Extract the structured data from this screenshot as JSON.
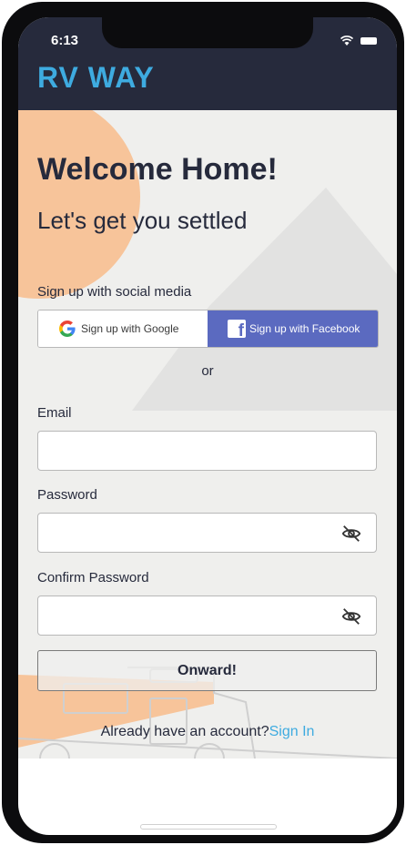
{
  "status_bar": {
    "time": "6:13"
  },
  "app": {
    "logo": "RV WAY"
  },
  "header": {
    "title": "Welcome Home!",
    "subtitle": "Let's get you settled"
  },
  "social": {
    "label": "Sign up with social media",
    "google_label": "Sign up with Google",
    "facebook_label": "Sign up with Facebook"
  },
  "divider_text": "or",
  "form": {
    "email_label": "Email",
    "email_value": "",
    "password_label": "Password",
    "password_value": "",
    "confirm_label": "Confirm Password",
    "confirm_value": "",
    "submit_label": "Onward!"
  },
  "footer": {
    "prompt": "Already have an account?",
    "signin_label": "Sign In"
  },
  "colors": {
    "header_bg": "#262a3c",
    "brand_blue": "#3eabe0",
    "facebook_blue": "#5b6ac0",
    "sun_orange": "#f7c49a"
  }
}
